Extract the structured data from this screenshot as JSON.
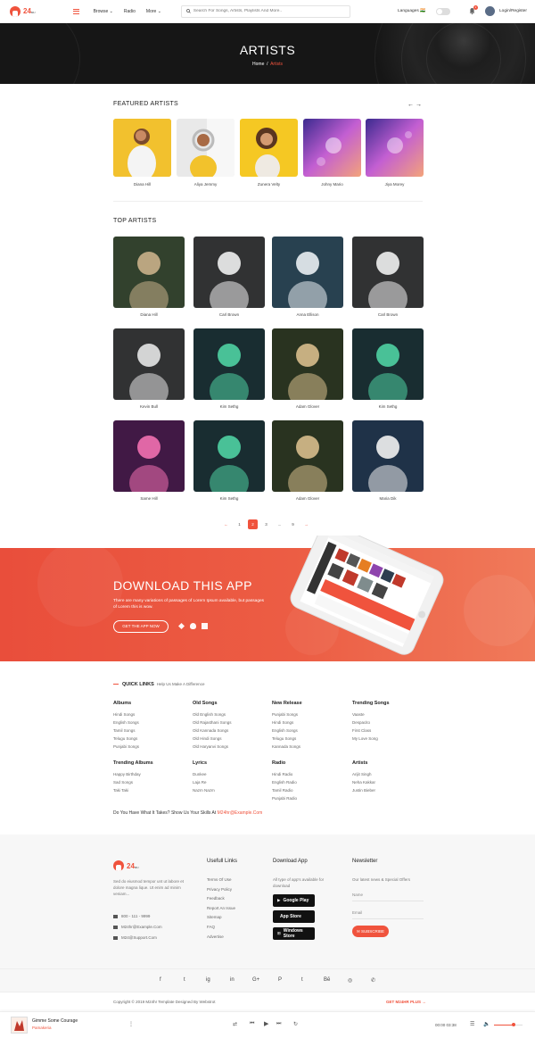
{
  "header": {
    "logo_text": "24",
    "logo_sub": "MU",
    "nav": [
      {
        "label": "Browse ⌄"
      },
      {
        "label": "Radio"
      },
      {
        "label": "More ⌄"
      }
    ],
    "search_placeholder": "Search For Songs, Artists, Playlists And More..",
    "languages_label": "Languages",
    "languages_flag": "🇮🇳",
    "notification_count": "2",
    "login_label": "Login/Register"
  },
  "banner": {
    "title": "ARTISTS",
    "breadcrumb_home": "Home",
    "breadcrumb_sep": "/",
    "breadcrumb_current": "Artists"
  },
  "featured": {
    "title": "FEATURED ARTISTS",
    "prev": "←",
    "next": "→",
    "artists": [
      {
        "name": "Diana Hill"
      },
      {
        "name": "Aliya Jemmy"
      },
      {
        "name": "Zunera Velty"
      },
      {
        "name": "Johny Mario"
      },
      {
        "name": "Jiya Morey"
      }
    ]
  },
  "top": {
    "title": "TOP ARTISTS",
    "artists": [
      {
        "name": "Diana Hill"
      },
      {
        "name": "Carl Brown"
      },
      {
        "name": "Anna Ellison"
      },
      {
        "name": "Carl Brown"
      },
      {
        "name": "Kevin Bull"
      },
      {
        "name": "Kim Sethg"
      },
      {
        "name": "Adam Glover"
      },
      {
        "name": "Kim Sethg"
      },
      {
        "name": "Same Hill"
      },
      {
        "name": "Kim Sethg"
      },
      {
        "name": "Adam Glover"
      },
      {
        "name": "Maria Dik"
      }
    ]
  },
  "pagination": {
    "prev": "←",
    "pages": [
      "1",
      "2",
      "3",
      "...",
      "9"
    ],
    "active_page": "2",
    "next": "→"
  },
  "download": {
    "title": "DOWNLOAD THIS APP",
    "desc": "There are many variations of passages of Lorem Ipsum available, but passages of Lorem this is wow.",
    "button": "GET THE APP NOW"
  },
  "quick_links": {
    "title": "QUICK LINKS",
    "subtitle": "Help Us Make A Difference",
    "columns": [
      {
        "heading": "Albums",
        "items": [
          "Hindi Songs",
          "English Songs",
          "Tamil Songs",
          "Telugu Songs",
          "Punjabi Songs"
        ]
      },
      {
        "heading": "Old Songs",
        "items": [
          "Old English Songs",
          "Old Rajasthani Songs",
          "Old Kannada Songs",
          "Old Hindi Songs",
          "Old Haryanvi Songs"
        ]
      },
      {
        "heading": "New Release",
        "items": [
          "Punjabi Songs",
          "Hindi Songs",
          "English Songs",
          "Telugu Songs",
          "Kannada Songs"
        ]
      },
      {
        "heading": "Trending Songs",
        "items": [
          "Vaaste",
          "Despacito",
          "First Class",
          "My Love Song"
        ]
      },
      {
        "heading": "Trending Albums",
        "items": [
          "Happy Birthday",
          "Sad Songs",
          "Taki Taki"
        ]
      },
      {
        "heading": "Lyrics",
        "items": [
          "Dunkee",
          "Laja Re",
          "Nazm Nazm"
        ]
      },
      {
        "heading": "Radio",
        "items": [
          "Hindi Radio",
          "English Radio",
          "Tamil Radio",
          "Punjabi Radio"
        ]
      },
      {
        "heading": "Artists",
        "items": [
          "Arijit Singh",
          "Neha Kakkar",
          "Justin Bieber"
        ]
      }
    ],
    "talent_text": "Do You Have What It Takes? Show Us Your Skills At",
    "talent_email": "M24hr@Example.Com"
  },
  "footer": {
    "about": "Sed do eiusmod tempor unt ut labore et dolore magna lique. Ut enim ad minim veniam...",
    "phone": "800 - 111 - 9999",
    "email1": "M24hr@Example.Com",
    "email2": "M24@Support.Com",
    "useful_title": "Usefull Links",
    "useful_links": [
      "Terms Of Use",
      "Privacy Policy",
      "Feedback",
      "Report An Issue",
      "Sitemap",
      "FAQ",
      "Advertise"
    ],
    "download_title": "Download App",
    "download_text": "All type of app's available for download",
    "stores": [
      {
        "small": "GET IT ON",
        "name": "Google Play"
      },
      {
        "small": "Download on the",
        "name": "App Store"
      },
      {
        "small": "Download from",
        "name": "Windows Store"
      }
    ],
    "newsletter_title": "Newsletter",
    "newsletter_text": "Our latest news & Special Offers",
    "name_placeholder": "Name",
    "email_placeholder": "Email",
    "subscribe": "SUBSCRIBE"
  },
  "social": [
    "f",
    "t",
    "ig",
    "in",
    "G+",
    "P",
    "t",
    "Bē",
    "◎",
    "✆"
  ],
  "copyright": "Copyright © 2019 M24hr Template Designed By Webstrot",
  "get_plus": "GET M24HR PLUS →",
  "player": {
    "song": "Gimme Some Courage",
    "artist": "Pamakeria",
    "time_current": "00:00",
    "time_total": "03:38",
    "volume": 0.7
  },
  "colors": {
    "accent": "#f0533d"
  }
}
